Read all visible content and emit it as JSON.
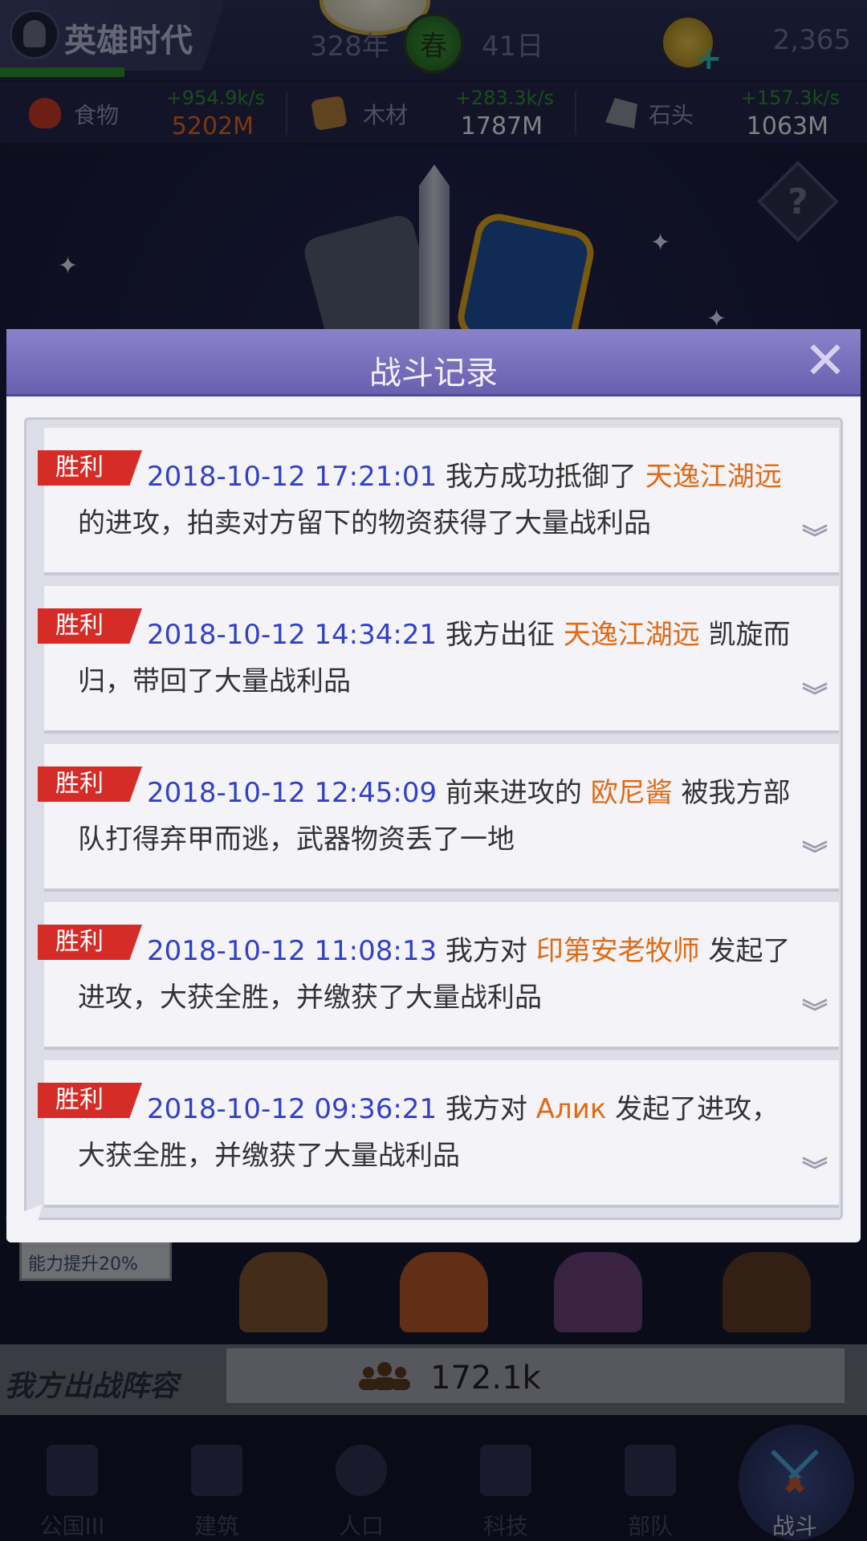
{
  "header": {
    "game_title": "英雄时代",
    "year": "328年",
    "season": "春",
    "day": "41日",
    "gold": "2,365"
  },
  "resources": [
    {
      "label": "食物",
      "rate": "+954.9k/s",
      "value": "5202M",
      "value_color": "#e0661a",
      "icon": "meat-icon"
    },
    {
      "label": "木材",
      "rate": "+283.3k/s",
      "value": "1787M",
      "value_color": "#e9e9f2",
      "icon": "wood-icon"
    },
    {
      "label": "石头",
      "rate": "+157.3k/s",
      "value": "1063M",
      "value_color": "#e9e9f2",
      "icon": "stone-icon"
    }
  ],
  "scene": {
    "buff_text": "能力提升20%",
    "lineup_label": "我方出战阵容",
    "power": "172.1k"
  },
  "nav": [
    {
      "label": "公国III",
      "icon": "castle-icon"
    },
    {
      "label": "建筑",
      "icon": "house-icon"
    },
    {
      "label": "人口",
      "icon": "person-icon"
    },
    {
      "label": "科技",
      "icon": "book-icon"
    },
    {
      "label": "部队",
      "icon": "banner-icon"
    },
    {
      "label": "战斗",
      "icon": "crossed-swords-icon",
      "active": true
    }
  ],
  "modal": {
    "title": "战斗记录",
    "entries": [
      {
        "tag": "胜利",
        "time": "2018-10-12 17:21:01",
        "before": " 我方成功抵御了 ",
        "name": "天逸江湖远",
        "after": "的进攻，拍卖对方留下的物资获得了大量战利品"
      },
      {
        "tag": "胜利",
        "time": "2018-10-12 14:34:21",
        "before": " 我方出征 ",
        "name": "天逸江湖远",
        "after": " 凯旋而归，带回了大量战利品"
      },
      {
        "tag": "胜利",
        "time": "2018-10-12 12:45:09",
        "before": " 前来进攻的 ",
        "name": "欧尼酱",
        "after": " 被我方部队打得弃甲而逃，武器物资丢了一地"
      },
      {
        "tag": "胜利",
        "time": "2018-10-12 11:08:13",
        "before": " 我方对 ",
        "name": "印第安老牧师",
        "after": " 发起了进攻，大获全胜，并缴获了大量战利品"
      },
      {
        "tag": "胜利",
        "time": "2018-10-12 09:36:21",
        "before": " 我方对 ",
        "name": "Алик",
        "after": " 发起了进攻，大获全胜，并缴获了大量战利品"
      }
    ]
  },
  "colors": {
    "timestamp": "#3240c8",
    "player_name": "#e06a15",
    "victory_tag": "#d62c28",
    "resource_rate": "#2f8d35"
  }
}
